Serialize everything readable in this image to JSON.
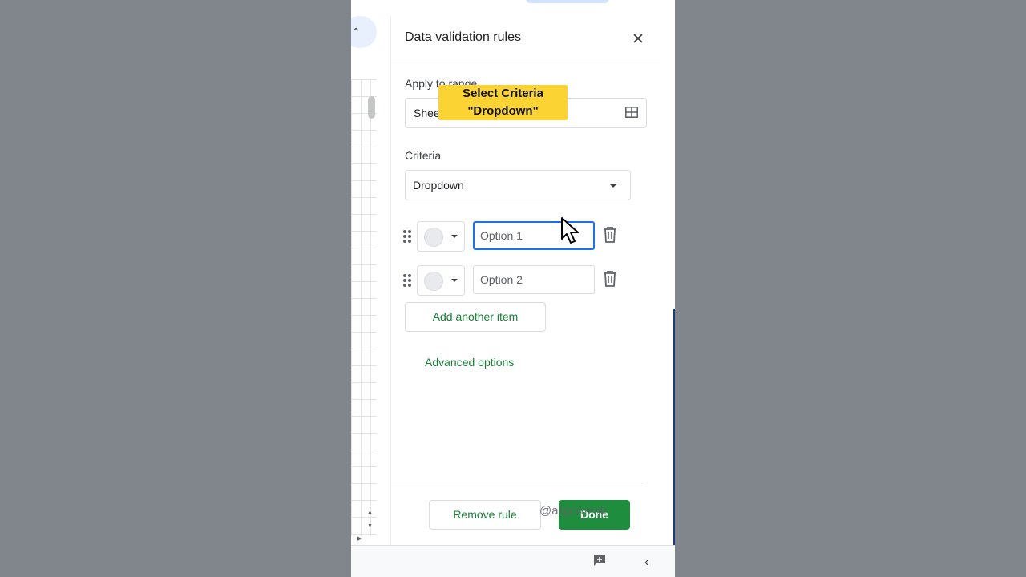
{
  "panel": {
    "title": "Data validation rules",
    "close_icon": "close-icon",
    "apply_label": "Apply to range",
    "range_value": "Sheet1!A1",
    "criteria_label": "Criteria",
    "criteria_value": "Dropdown",
    "items": [
      {
        "placeholder": "Option 1",
        "focused": true
      },
      {
        "placeholder": "Option 2",
        "focused": false
      }
    ],
    "add_item_label": "Add another item",
    "advanced_label": "Advanced options",
    "remove_label": "Remove rule",
    "done_label": "Done"
  },
  "overlay": {
    "tooltip_line1": "Select Criteria",
    "tooltip_line2": "\"Dropdown\"",
    "watermark": "@alignmentl"
  },
  "colors": {
    "accent_green": "#1e8e3e",
    "focus_blue": "#1a73e8",
    "tooltip_yellow": "#fbd333"
  }
}
